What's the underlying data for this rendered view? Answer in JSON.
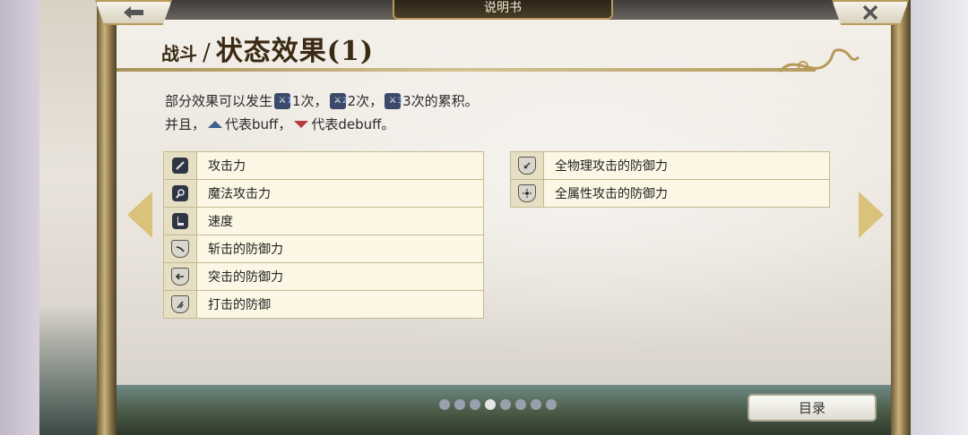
{
  "window": {
    "title": "说明书"
  },
  "nav": {
    "back_icon": "left-arrow",
    "close_icon": "close-x"
  },
  "page": {
    "title_prefix": "战斗",
    "title_slash": "/",
    "title_main": "状态效果(1)"
  },
  "description": {
    "line1": {
      "prefix": "部分效果可以发生",
      "count1": "1次，",
      "count2": "2次，",
      "count3": "3次的累积。",
      "icon_badges": [
        "1",
        "2",
        "3"
      ]
    },
    "line2": {
      "prefix": "并且，",
      "buff_text": "代表buff，",
      "debuff_text": "代表debuff。",
      "buff_color": "#3e5f8f",
      "debuff_color": "#b83a3a"
    }
  },
  "effects_left": [
    {
      "label": "攻击力",
      "icon": "sword-icon"
    },
    {
      "label": "魔法攻击力",
      "icon": "magic-staff-icon"
    },
    {
      "label": "速度",
      "icon": "boot-icon"
    },
    {
      "label": "斩击的防御力",
      "icon": "slash-shield-icon"
    },
    {
      "label": "突击的防御力",
      "icon": "thrust-shield-icon"
    },
    {
      "label": "打击的防御",
      "icon": "blunt-shield-icon"
    }
  ],
  "effects_right": [
    {
      "label": "全物理攻击的防御力",
      "icon": "physical-shield-icon"
    },
    {
      "label": "全属性攻击的防御力",
      "icon": "element-shield-icon"
    }
  ],
  "pagination": {
    "total": 8,
    "active_index": 3
  },
  "toc_button": {
    "label": "目录"
  },
  "colors": {
    "accent_gold": "#b79a5a",
    "row_bg": "#fbf7e4",
    "icon_dark": "#2e3545"
  }
}
